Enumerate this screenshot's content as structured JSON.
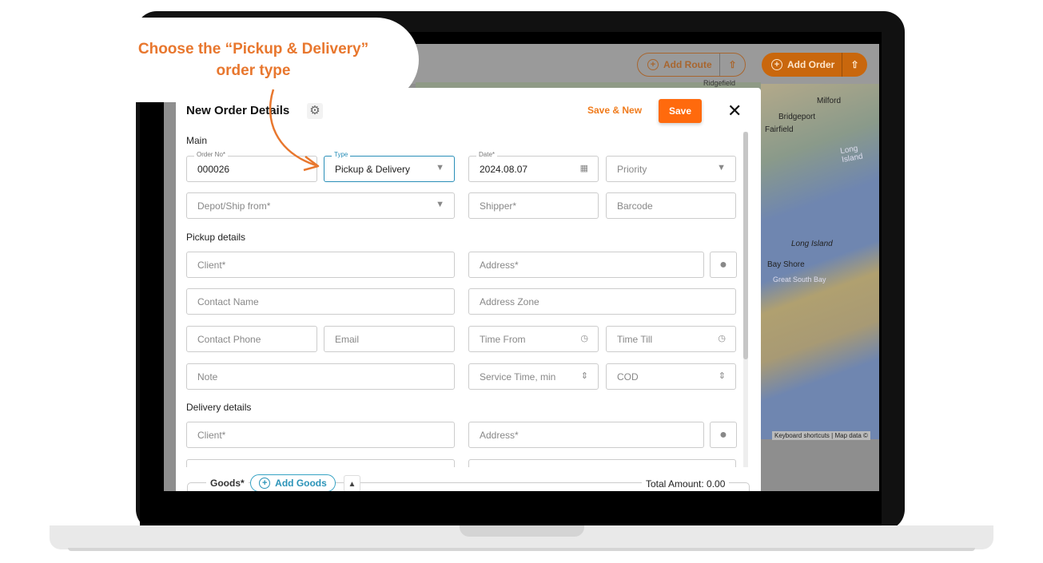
{
  "callout": {
    "line1": "Choose the  “Pickup & Delivery”",
    "line2": "order type"
  },
  "header": {
    "add_route": "Add Route",
    "add_order": "Add Order",
    "upload_icon": "upload-icon",
    "plus_icon": "plus-circle-icon"
  },
  "map": {
    "labels": [
      "Ridgefield",
      "Milford",
      "Bridgeport",
      "Fairfield",
      "Long Island",
      "Bay Shore",
      "Great South Bay"
    ],
    "footer": [
      "Keyboard shortcuts",
      "Map data ©"
    ]
  },
  "modal": {
    "title": "New Order Details",
    "save_new": "Save & New",
    "save": "Save",
    "close": "✕",
    "main": {
      "label": "Main",
      "order_no": {
        "label": "Order No*",
        "value": "000026"
      },
      "type": {
        "label": "Type",
        "value": "Pickup & Delivery"
      },
      "date": {
        "label": "Date*",
        "value": "2024.08.07"
      },
      "priority": "Priority",
      "depot": "Depot/Ship from*",
      "shipper": "Shipper*",
      "barcode": "Barcode"
    },
    "pickup": {
      "label": "Pickup details",
      "client": "Client*",
      "address": "Address*",
      "contact_name": "Contact Name",
      "address_zone": "Address Zone",
      "contact_phone": "Contact Phone",
      "email": "Email",
      "time_from": "Time From",
      "time_till": "Time Till",
      "note": "Note",
      "service_time": "Service Time, min",
      "cod": "COD"
    },
    "delivery": {
      "label": "Delivery details",
      "client": "Client*",
      "address": "Address*"
    },
    "goods": {
      "label": "Goods*",
      "add": "Add Goods",
      "total": "Total Amount: 0.00"
    }
  },
  "colors": {
    "accent": "#ff6a0d",
    "focus": "#2a8fb8",
    "callout": "#e8772e"
  }
}
